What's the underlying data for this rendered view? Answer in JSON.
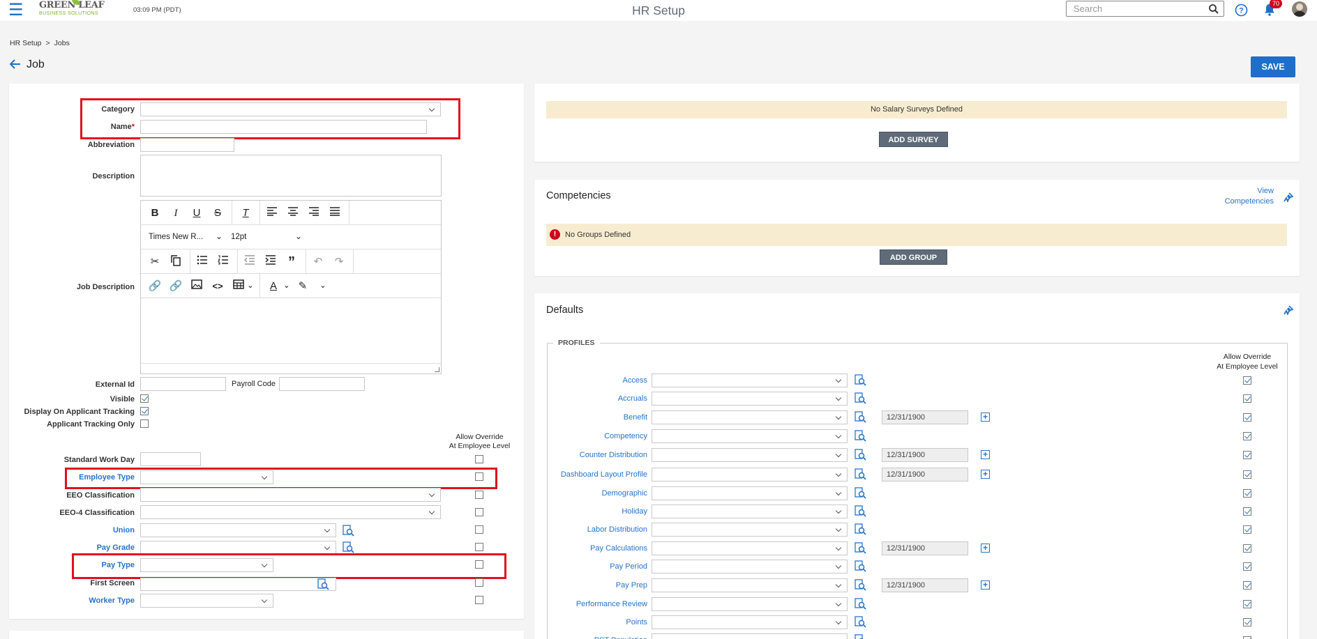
{
  "header": {
    "menu_icon": "hamburger-icon",
    "logo_line1": "GREEN LEAF",
    "logo_line2": "BUSINESS SOLUTIONS",
    "time": "03:09 PM (PDT)",
    "app_title": "HR Setup",
    "search_placeholder": "Search",
    "notifications_count": "70"
  },
  "breadcrumb": {
    "root": "HR Setup",
    "separator": ">",
    "current": "Jobs"
  },
  "page": {
    "title": "Job",
    "save_label": "SAVE"
  },
  "form": {
    "category_label": "Category",
    "name_label": "Name",
    "name_required_marker": "*",
    "abbreviation_label": "Abbreviation",
    "description_label": "Description",
    "job_description_label": "Job Description",
    "editor": {
      "font_family": "Times New R...",
      "font_size": "12pt"
    },
    "external_id_label": "External Id",
    "payroll_code_label": "Payroll Code",
    "visible_label": "Visible",
    "visible_checked": true,
    "display_on_applicant_label": "Display On Applicant Tracking",
    "display_on_applicant_checked": true,
    "applicant_only_label": "Applicant Tracking Only",
    "applicant_only_checked": false,
    "allow_override_line1": "Allow Override",
    "allow_override_line2": "At Employee Level",
    "standard_work_day_label": "Standard Work Day",
    "employee_type_label": "Employee Type",
    "eeo_label": "EEO Classification",
    "eeo4_label": "EEO-4 Classification",
    "union_label": "Union",
    "pay_grade_label": "Pay Grade",
    "pay_type_label": "Pay Type",
    "first_screen_label": "First Screen",
    "worker_type_label": "Worker Type"
  },
  "salary": {
    "empty_text": "No Salary Surveys Defined",
    "add_label": "ADD SURVEY"
  },
  "competencies": {
    "title": "Competencies",
    "view_line1": "View",
    "view_line2": "Competencies",
    "empty_text": "No Groups Defined",
    "add_label": "ADD GROUP"
  },
  "defaults": {
    "title": "Defaults",
    "profiles_legend": "PROFILES",
    "allow_override_line1": "Allow Override",
    "allow_override_line2": "At Employee Level",
    "rows": [
      {
        "label": "Access",
        "date": ""
      },
      {
        "label": "Accruals",
        "date": ""
      },
      {
        "label": "Benefit",
        "date": "12/31/1900"
      },
      {
        "label": "Competency",
        "date": ""
      },
      {
        "label": "Counter Distribution",
        "date": "12/31/1900"
      },
      {
        "label": "Dashboard Layout Profile",
        "date": "12/31/1900"
      },
      {
        "label": "Demographic",
        "date": ""
      },
      {
        "label": "Holiday",
        "date": ""
      },
      {
        "label": "Labor Distribution",
        "date": ""
      },
      {
        "label": "Pay Calculations",
        "date": "12/31/1900"
      },
      {
        "label": "Pay Period",
        "date": ""
      },
      {
        "label": "Pay Prep",
        "date": "12/31/1900"
      },
      {
        "label": "Performance Review",
        "date": ""
      },
      {
        "label": "Points",
        "date": ""
      },
      {
        "label": "PST Population",
        "date": ""
      }
    ]
  },
  "colors": {
    "accent": "#1e6fc9",
    "highlight": "#e0101c",
    "notice_bg": "#f8ecd0",
    "button_gray": "#5f6b78"
  }
}
